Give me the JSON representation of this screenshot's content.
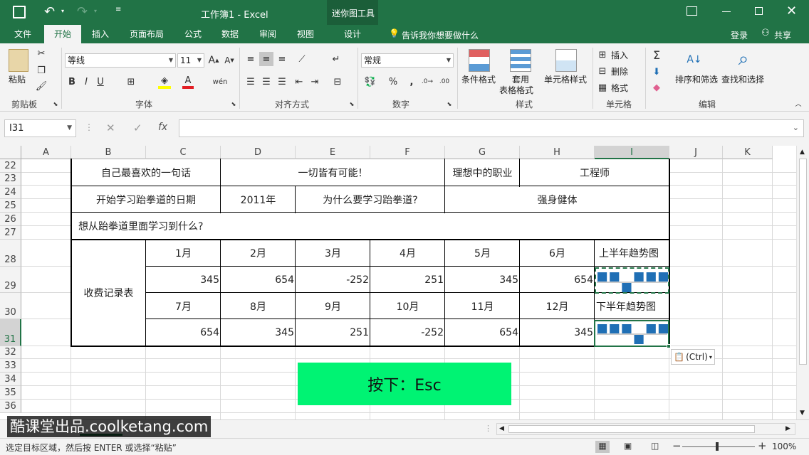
{
  "title": {
    "doc": "工作簿1 - Excel",
    "context_tools": "迷你图工具"
  },
  "tabs": [
    "文件",
    "开始",
    "插入",
    "页面布局",
    "公式",
    "数据",
    "审阅",
    "视图",
    "设计"
  ],
  "tell_me": "告诉我你想要做什么",
  "login": "登录",
  "share": "共享",
  "ribbon": {
    "paste": "粘贴",
    "clipboard": "剪贴板",
    "font_name": "等线",
    "font_size": "11",
    "font": "字体",
    "align": "对齐方式",
    "number_format": "常规",
    "number": "数字",
    "cond_format": "条件格式",
    "table_format_1": "套用",
    "table_format_2": "表格格式",
    "cell_style": "单元格样式",
    "styles": "样式",
    "insert": "插入",
    "delete": "删除",
    "format": "格式",
    "cells": "单元格",
    "sort_filter": "排序和筛选",
    "find_select": "查找和选择",
    "editing": "编辑"
  },
  "formula_bar": {
    "name_box": "I31",
    "formula": ""
  },
  "columns": [
    "A",
    "B",
    "C",
    "D",
    "E",
    "F",
    "G",
    "H",
    "I",
    "J",
    "K"
  ],
  "rows": [
    "22",
    "23",
    "24",
    "25",
    "26",
    "27",
    "28",
    "29",
    "30",
    "31",
    "32",
    "33",
    "34",
    "35",
    "36"
  ],
  "cells": {
    "r1b": "自己最喜欢的一句话",
    "r1d": "一切皆有可能！",
    "r1g": "理想中的职业",
    "r1h": "工程师",
    "r2b": "开始学习跆拳道的日期",
    "r2d": "2011年",
    "r2e": "为什么要学习跆拳道?",
    "r2h": "强身健体",
    "r3b": "想从跆拳道里面学习到什么?",
    "fee_label": "收费记录表",
    "months1": [
      "1月",
      "2月",
      "3月",
      "4月",
      "5月",
      "6月"
    ],
    "values1": [
      "345",
      "654",
      "-252",
      "251",
      "345",
      "654"
    ],
    "months2": [
      "7月",
      "8月",
      "9月",
      "10月",
      "11月",
      "12月"
    ],
    "values2": [
      "654",
      "345",
      "251",
      "-252",
      "654",
      "345"
    ],
    "trend1": "上半年趋势图",
    "trend2": "下半年趋势图"
  },
  "sparkline": {
    "values1": [
      345,
      654,
      -252,
      251,
      345,
      654
    ],
    "values2": [
      654,
      345,
      251,
      -252,
      654,
      345
    ],
    "color": "#1f6fb5"
  },
  "paste_options": "(Ctrl)",
  "banner": "按下：Esc",
  "watermark": "酷课堂出品.coolketang.com",
  "status": {
    "message": "选定目标区域，然后按 ENTER 或选择“粘贴”",
    "zoom": "100%"
  },
  "colors": {
    "accent": "#217346",
    "banner": "#00f373"
  }
}
